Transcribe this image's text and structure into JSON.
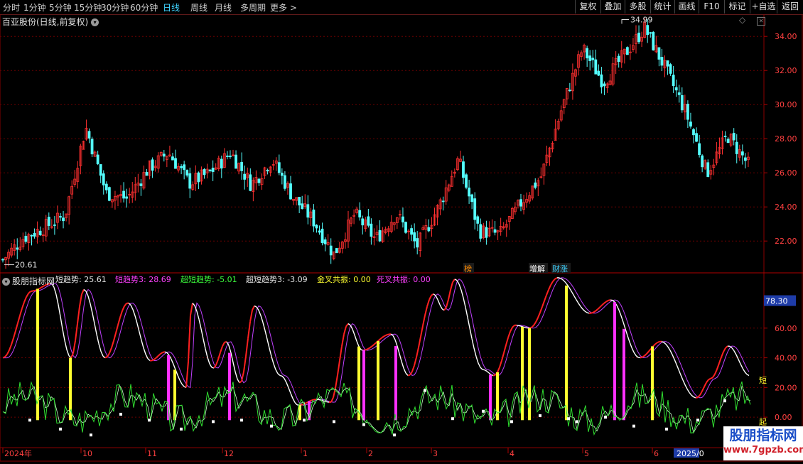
{
  "toolbar": {
    "periods": [
      "分时",
      "1分钟",
      "5分钟",
      "15分钟",
      "30分钟",
      "60分钟",
      "日线",
      "周线",
      "月线",
      "多周期",
      "更多 >"
    ],
    "active_period": "日线",
    "right_buttons": [
      "复权",
      "叠加",
      "多股",
      "统计",
      "画线",
      "F10",
      "标记",
      "+自选",
      "返回"
    ]
  },
  "main_chart": {
    "stock_title": "百亚股份(日线,前复权)",
    "price_axis": [
      "34.00",
      "32.00",
      "30.00",
      "28.00",
      "26.00",
      "24.00",
      "22.00"
    ],
    "price_range": [
      20.3,
      35.3
    ],
    "high_label": "34.99",
    "low_label": "20.61",
    "event_tags": [
      {
        "text": "榜",
        "color": "#ff8a00"
      },
      {
        "text": "增解",
        "color": "#ffffff"
      },
      {
        "text": "财涨",
        "color": "#3fd3ff"
      }
    ],
    "candle_up_color": "#ff3030",
    "candle_down_color": "#54ffff"
  },
  "indicator": {
    "name": "股朋指标网",
    "params": [
      {
        "label": "短趋势",
        "value": "25.61",
        "color": "#e8e8e8"
      },
      {
        "label": "短趋势3",
        "value": "28.69",
        "color": "#ff40ff"
      },
      {
        "label": "超短趋势",
        "value": "-5.01",
        "color": "#3cff3c"
      },
      {
        "label": "超短趋势3",
        "value": "-3.09",
        "color": "#e8e8e8"
      },
      {
        "label": "金叉共振",
        "value": "0.00",
        "color": "#ffff30"
      },
      {
        "label": "死叉共振",
        "value": "0.00",
        "color": "#ff40ff"
      }
    ],
    "axis": [
      "60.00",
      "40.00",
      "20.00",
      "0.00"
    ],
    "current_value": "78.30",
    "right_edge_labels": [
      "短",
      "起"
    ]
  },
  "time_axis": [
    "2024年",
    "10",
    "11",
    "12",
    "1",
    "2",
    "3",
    "4",
    "5",
    "6",
    "2025/0"
  ],
  "watermark": {
    "line1": "股朋指标网",
    "line2": "www.7gpzb.com"
  },
  "chart_data": {
    "type": "candlestick",
    "title": "百亚股份(日线,前复权)",
    "y_ticks": [
      22,
      24,
      26,
      28,
      30,
      32,
      34
    ],
    "x_ticks": [
      "2024年",
      "10",
      "11",
      "12",
      "1",
      "2",
      "3",
      "4",
      "5",
      "6",
      "2025/0"
    ],
    "close_path": [
      {
        "month": "2024年",
        "price": 20.9
      },
      {
        "month": "2024年",
        "price": 22.2
      },
      {
        "month": "2024年",
        "price": 22.8
      },
      {
        "month": "2024年",
        "price": 23.5
      },
      {
        "month": "10",
        "price": 28.7
      },
      {
        "month": "10",
        "price": 24.8
      },
      {
        "month": "10",
        "price": 24.5
      },
      {
        "month": "10",
        "price": 26.2
      },
      {
        "month": "10",
        "price": 27.2
      },
      {
        "month": "11",
        "price": 25.4
      },
      {
        "month": "11",
        "price": 26.0
      },
      {
        "month": "11",
        "price": 27.2
      },
      {
        "month": "11",
        "price": 25.3
      },
      {
        "month": "12",
        "price": 26.8
      },
      {
        "month": "12",
        "price": 24.6
      },
      {
        "month": "12",
        "price": 23.2
      },
      {
        "month": "1",
        "price": 21.2
      },
      {
        "month": "1",
        "price": 23.6
      },
      {
        "month": "1",
        "price": 22.1
      },
      {
        "month": "2",
        "price": 23.6
      },
      {
        "month": "2",
        "price": 21.7
      },
      {
        "month": "2",
        "price": 23.9
      },
      {
        "month": "3",
        "price": 26.8
      },
      {
        "month": "3",
        "price": 22.6
      },
      {
        "month": "3",
        "price": 22.4
      },
      {
        "month": "4",
        "price": 24.2
      },
      {
        "month": "4",
        "price": 25.8
      },
      {
        "month": "4",
        "price": 29.8
      },
      {
        "month": "5",
        "price": 33.3
      },
      {
        "month": "5",
        "price": 31.3
      },
      {
        "month": "5",
        "price": 32.9
      },
      {
        "month": "5",
        "price": 34.5
      },
      {
        "month": "6",
        "price": 32.1
      },
      {
        "month": "6",
        "price": 29.5
      },
      {
        "month": "6",
        "price": 26.0
      },
      {
        "month": "6",
        "price": 28.2
      },
      {
        "month": "2025/0",
        "price": 26.5
      }
    ],
    "high": 34.99,
    "low": 20.61,
    "indicator_axis": [
      0,
      20,
      40,
      60
    ],
    "indicator_last": {
      "短趋势": 25.61,
      "短趋势3": 28.69,
      "超短趋势": -5.01,
      "超短趋势3": -3.09
    }
  }
}
